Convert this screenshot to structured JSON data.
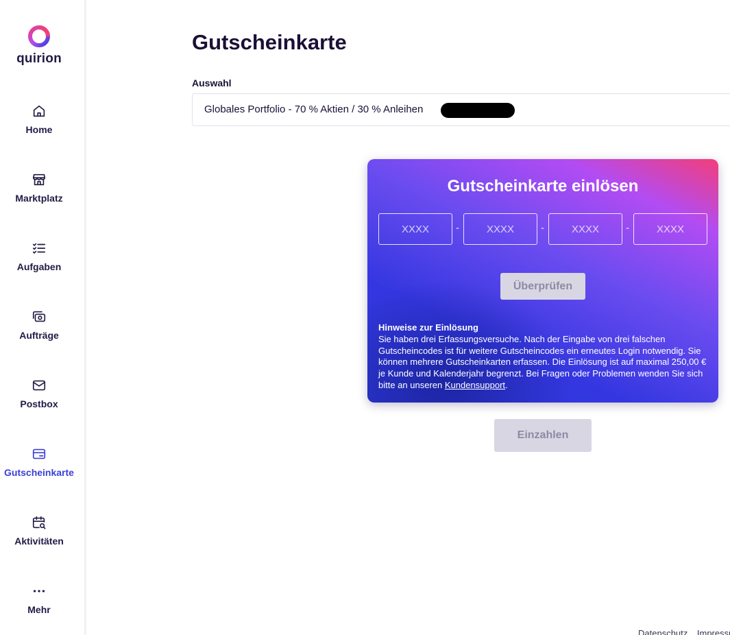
{
  "brand": {
    "name": "quirion"
  },
  "sidebar": {
    "items": [
      {
        "label": "Home",
        "icon": "home-icon"
      },
      {
        "label": "Marktplatz",
        "icon": "store-icon"
      },
      {
        "label": "Aufgaben",
        "icon": "checklist-icon"
      },
      {
        "label": "Aufträge",
        "icon": "money-icon"
      },
      {
        "label": "Postbox",
        "icon": "mail-icon"
      },
      {
        "label": "Gutscheinkarte",
        "icon": "voucher-card-icon",
        "active": true
      },
      {
        "label": "Aktivitäten",
        "icon": "calendar-search-icon"
      },
      {
        "label": "Mehr",
        "icon": "more-dots-icon"
      }
    ],
    "active_color": "#3b3fd6"
  },
  "main": {
    "title": "Gutscheinkarte",
    "select_label": "Auswahl",
    "select_value": "Globales Portfolio - 70 % Aktien / 30 % Anleihen"
  },
  "voucher": {
    "title": "Gutscheinkarte einlösen",
    "code_placeholders": [
      "XXXX",
      "XXXX",
      "XXXX",
      "XXXX"
    ],
    "separator": "-",
    "check_label": "Überprüfen",
    "notes_title": "Hinweise zur Einlösung",
    "notes_text": "Sie haben drei Erfassungsversuche. Nach der Eingabe von drei falschen Gutscheincodes ist für weitere Gutscheincodes ein erneutes Login notwendig. Sie können mehrere Gutscheinkarten erfassen. Die Einlösung ist auf maximal 250,00 € je Kunde und Kalenderjahr begrenzt. Bei Fragen oder Problemen wenden Sie sich bitte an unseren ",
    "notes_link": "Kundensupport",
    "notes_end": "."
  },
  "deposit_label": "Einzahlen",
  "footer": {
    "privacy": "Datenschutz",
    "imprint": "Impressum"
  },
  "colors": {
    "gradient_pink": "#f23e7a",
    "gradient_purple": "#b24cf3",
    "gradient_blue": "#2d36d3",
    "disabled_bg": "#d9d6e4",
    "disabled_text": "#8f8aa3"
  }
}
